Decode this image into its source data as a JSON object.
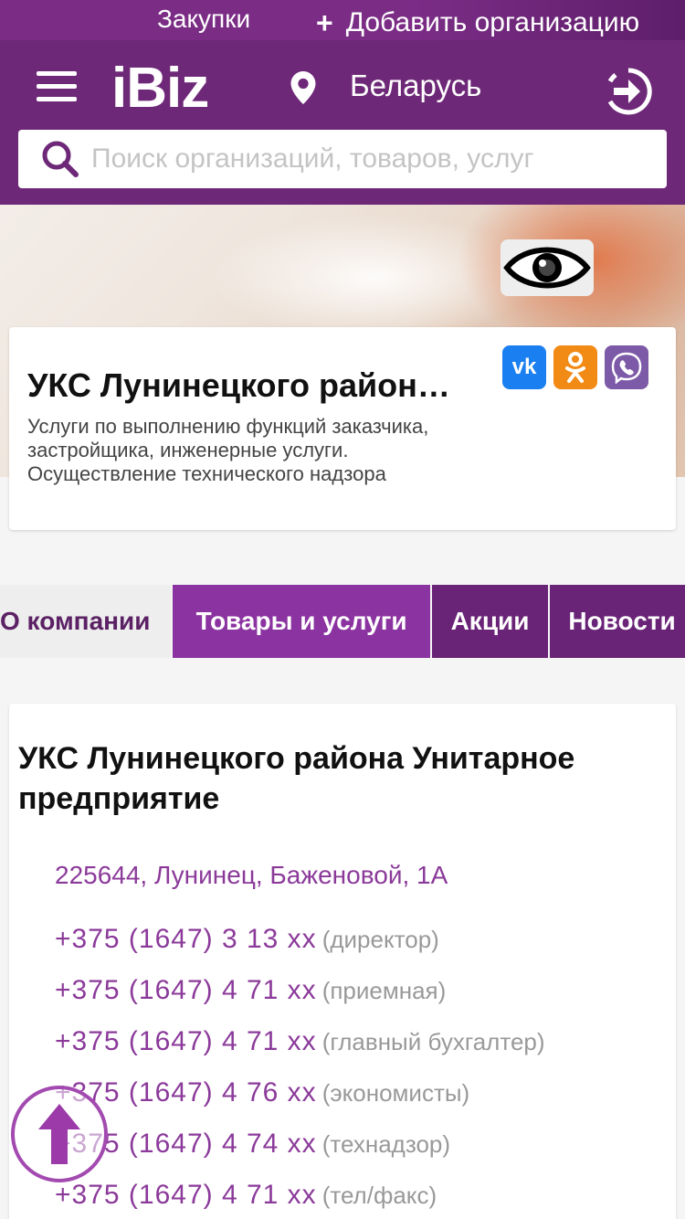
{
  "topbar": {
    "purchases_label": "Закупки",
    "add_org_label": "Добавить организацию"
  },
  "header": {
    "logo": "iBiz",
    "region": "Беларусь"
  },
  "search": {
    "placeholder": "Поиск организаций, товаров, услуг"
  },
  "company_card": {
    "name": "УКС Лунинецкого района Унитарное предприятие",
    "description": "Услуги по выполнению функций заказчика, застройщика, инженерные услуги. Осуществление технического надзора",
    "social": [
      "vk-icon",
      "odnoklassniki-icon",
      "viber-icon"
    ]
  },
  "tabs": [
    {
      "label": "О компании"
    },
    {
      "label": "Товары и услуги"
    },
    {
      "label": "Акции"
    },
    {
      "label": "Новости"
    }
  ],
  "info": {
    "full_name": "УКС Лунинецкого района Унитарное предприятие",
    "address": "225644, Лунинец, Баженовой, 1А",
    "phones": [
      {
        "number": "+375 (1647) 3 13 xx",
        "role": "(директор)"
      },
      {
        "number": "+375 (1647) 4 71 xx",
        "role": "(приемная)"
      },
      {
        "number": "+375 (1647) 4 71 xx",
        "role": "(главный бухгалтер)"
      },
      {
        "number": "+375 (1647) 4 76 xx",
        "role": "(экономисты)"
      },
      {
        "number": "+375 (1647) 4 74 xx",
        "role": "(технадзор)"
      },
      {
        "number": "+375 (1647) 4 71 xx",
        "role": "(тел/факс)"
      }
    ]
  },
  "colors": {
    "brand_purple": "#6e2878",
    "accent_purple": "#8b33a0",
    "link_purple": "#8b3a9a"
  }
}
